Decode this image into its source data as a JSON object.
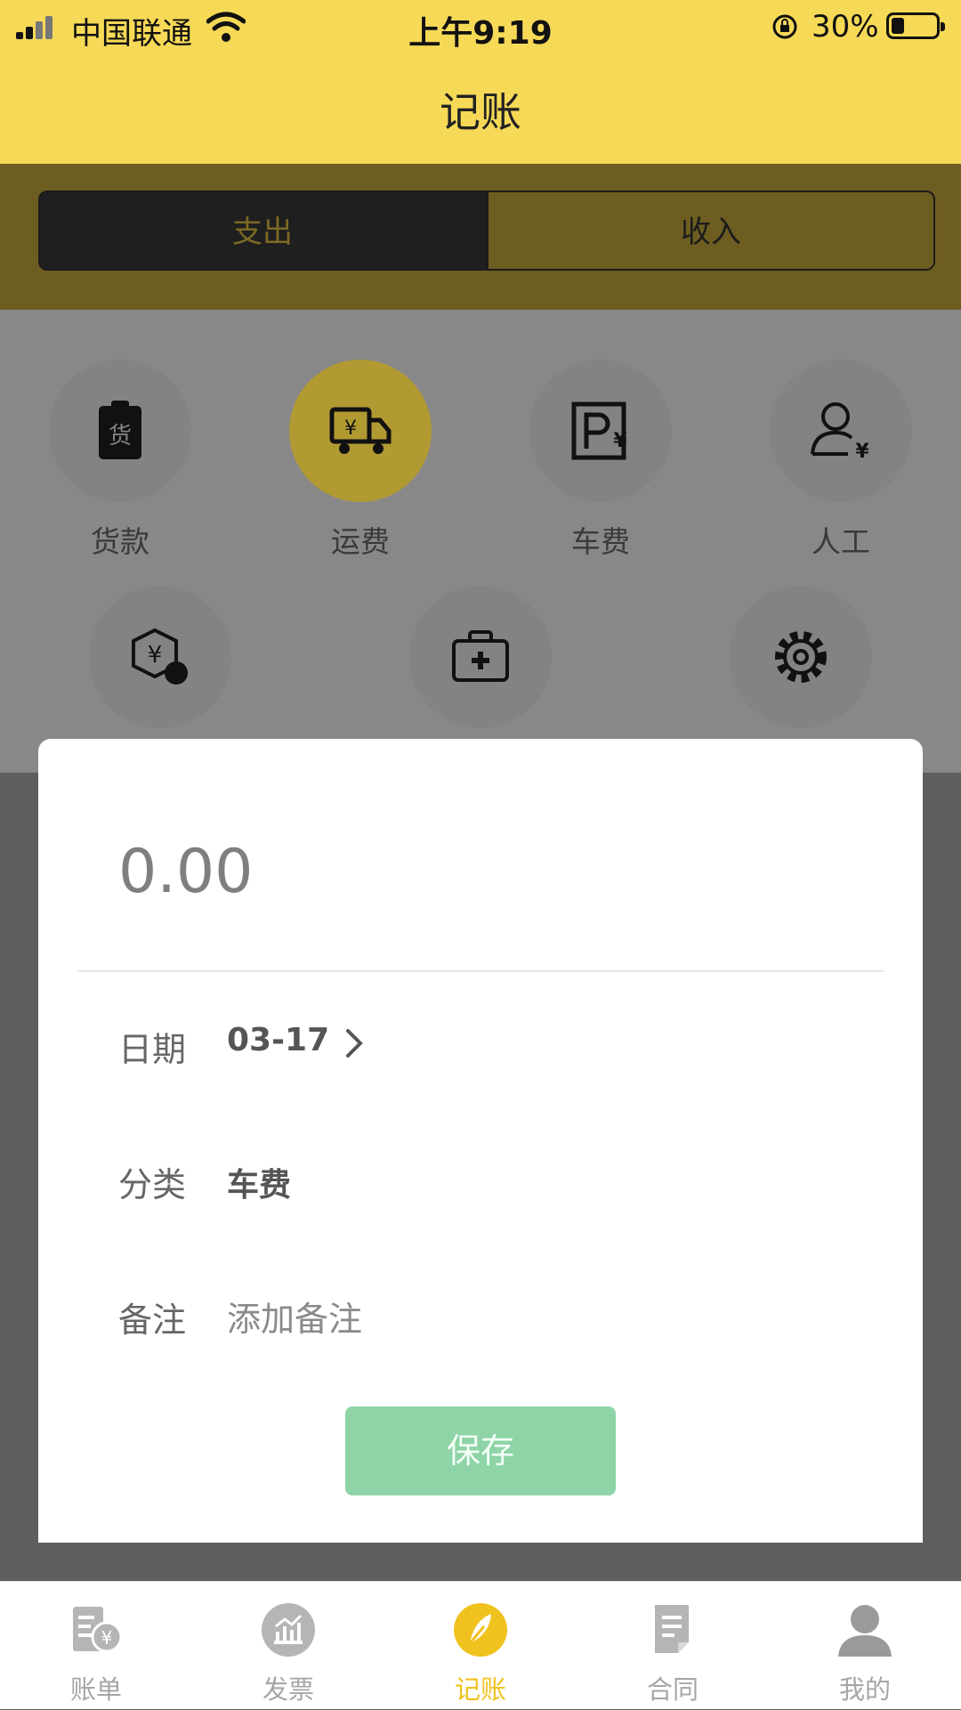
{
  "status_bar": {
    "carrier": "中国联通",
    "time": "上午9:19",
    "battery": "30%"
  },
  "nav": {
    "title": "记账"
  },
  "segment": {
    "expense": "支出",
    "income": "收入",
    "selected": "expense"
  },
  "categories": [
    {
      "label": "货款",
      "icon": "goods-clipboard-icon",
      "selected": false
    },
    {
      "label": "运费",
      "icon": "truck-yuan-icon",
      "selected": true
    },
    {
      "label": "车费",
      "icon": "parking-yuan-icon",
      "selected": false
    },
    {
      "label": "人工",
      "icon": "person-yuan-icon",
      "selected": false
    },
    {
      "icon": "repay-hexagon-icon",
      "selected": false
    },
    {
      "icon": "medical-kit-icon",
      "selected": false
    },
    {
      "icon": "gear-icon",
      "selected": false
    }
  ],
  "form": {
    "amount": "0.00",
    "date_label": "日期",
    "date_value": "03-17",
    "category_label": "分类",
    "category_value": "车费",
    "note_label": "备注",
    "note_placeholder": "添加备注",
    "save_label": "保存"
  },
  "tabs": [
    {
      "label": "账单",
      "icon": "bill-icon",
      "active": false
    },
    {
      "label": "发票",
      "icon": "invoice-chart-icon",
      "active": false
    },
    {
      "label": "记账",
      "icon": "feather-icon",
      "active": true
    },
    {
      "label": "合同",
      "icon": "contract-doc-icon",
      "active": false
    },
    {
      "label": "我的",
      "icon": "user-profile-icon",
      "active": false
    }
  ],
  "colors": {
    "accent_yellow": "#f6d956",
    "save_green": "#8ed4a6",
    "tab_active": "#f0c21e",
    "tab_inactive": "#a6a6a6"
  }
}
